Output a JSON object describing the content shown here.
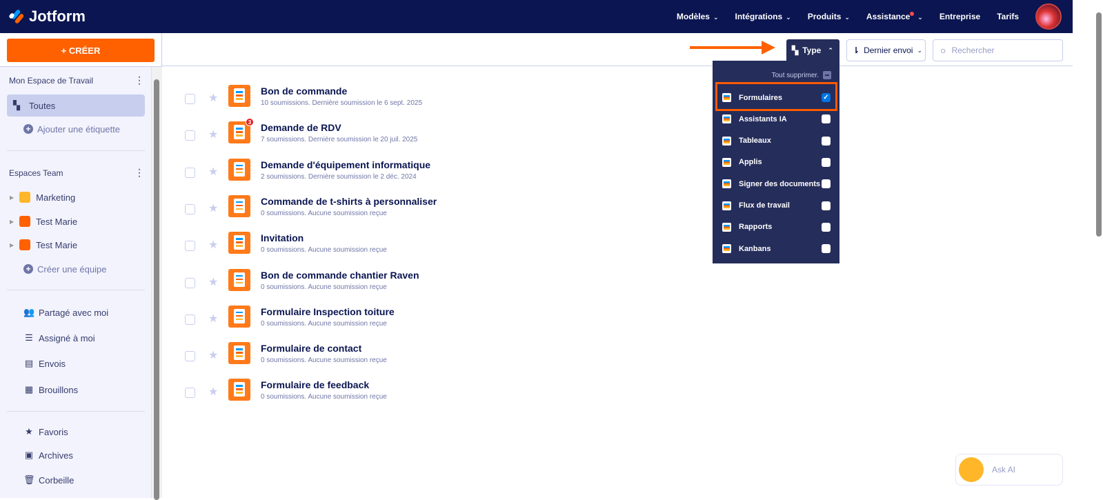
{
  "header": {
    "brand": "Jotform",
    "nav": [
      {
        "label": "Modèles",
        "dropdown": true
      },
      {
        "label": "Intégrations",
        "dropdown": true
      },
      {
        "label": "Produits",
        "dropdown": true
      },
      {
        "label": "Assistance",
        "dropdown": true,
        "notification": true
      },
      {
        "label": "Entreprise"
      },
      {
        "label": "Tarifs"
      }
    ]
  },
  "sidebar": {
    "create_label": "+ CRÉER",
    "workspace_title": "Mon Espace de Travail",
    "all_label": "Toutes",
    "add_label": "Ajouter une étiquette",
    "teams_title": "Espaces Team",
    "teams": [
      {
        "label": "Marketing",
        "color": "#ffb629"
      },
      {
        "label": "Test Marie",
        "color": "#ff6100"
      },
      {
        "label": "Test Marie",
        "color": "#ff6100"
      }
    ],
    "create_team": "Créer une équipe",
    "links": [
      {
        "label": "Partagé avec moi",
        "icon": "users-icon"
      },
      {
        "label": "Assigné à moi",
        "icon": "checklist-icon"
      },
      {
        "label": "Envois",
        "icon": "inbox-icon"
      },
      {
        "label": "Brouillons",
        "icon": "draft-icon"
      }
    ],
    "links2": [
      {
        "label": "Favoris",
        "icon": "star-icon"
      },
      {
        "label": "Archives",
        "icon": "archive-icon"
      },
      {
        "label": "Corbeille",
        "icon": "trash-icon"
      }
    ]
  },
  "toolbar": {
    "type_label": "Type",
    "sort_label": "Dernier envoi",
    "search_placeholder": "Rechercher"
  },
  "type_filter": {
    "clear_label": "Tout supprimer.",
    "options": [
      {
        "label": "Formulaires",
        "checked": true
      },
      {
        "label": "Assistants IA",
        "checked": false
      },
      {
        "label": "Tableaux",
        "checked": false
      },
      {
        "label": "Applis",
        "checked": false
      },
      {
        "label": "Signer des documents",
        "checked": false
      },
      {
        "label": "Flux de travail",
        "checked": false
      },
      {
        "label": "Rapports",
        "checked": false
      },
      {
        "label": "Kanbans",
        "checked": false
      }
    ]
  },
  "forms": [
    {
      "title": "Bon de commande",
      "sub": "10 soumissions. Dernière soumission le 6 sept. 2025"
    },
    {
      "title": "Demande de RDV",
      "sub": "7 soumissions. Dernière soumission le 20 juil. 2025",
      "badge": "3"
    },
    {
      "title": "Demande d'équipement informatique",
      "sub": "2 soumissions. Dernière soumission le 2 déc. 2024"
    },
    {
      "title": "Commande de t-shirts à personnaliser",
      "sub": "0 soumissions. Aucune soumission reçue"
    },
    {
      "title": "Invitation",
      "sub": "0 soumissions. Aucune soumission reçue"
    },
    {
      "title": "Bon de commande chantier Raven",
      "sub": "0 soumissions. Aucune soumission reçue"
    },
    {
      "title": "Formulaire Inspection toiture",
      "sub": "0 soumissions. Aucune soumission reçue"
    },
    {
      "title": "Formulaire de contact",
      "sub": "0 soumissions. Aucune soumission reçue"
    },
    {
      "title": "Formulaire de feedback",
      "sub": "0 soumissions. Aucune soumission reçue"
    }
  ],
  "ask_ai": "Ask AI"
}
